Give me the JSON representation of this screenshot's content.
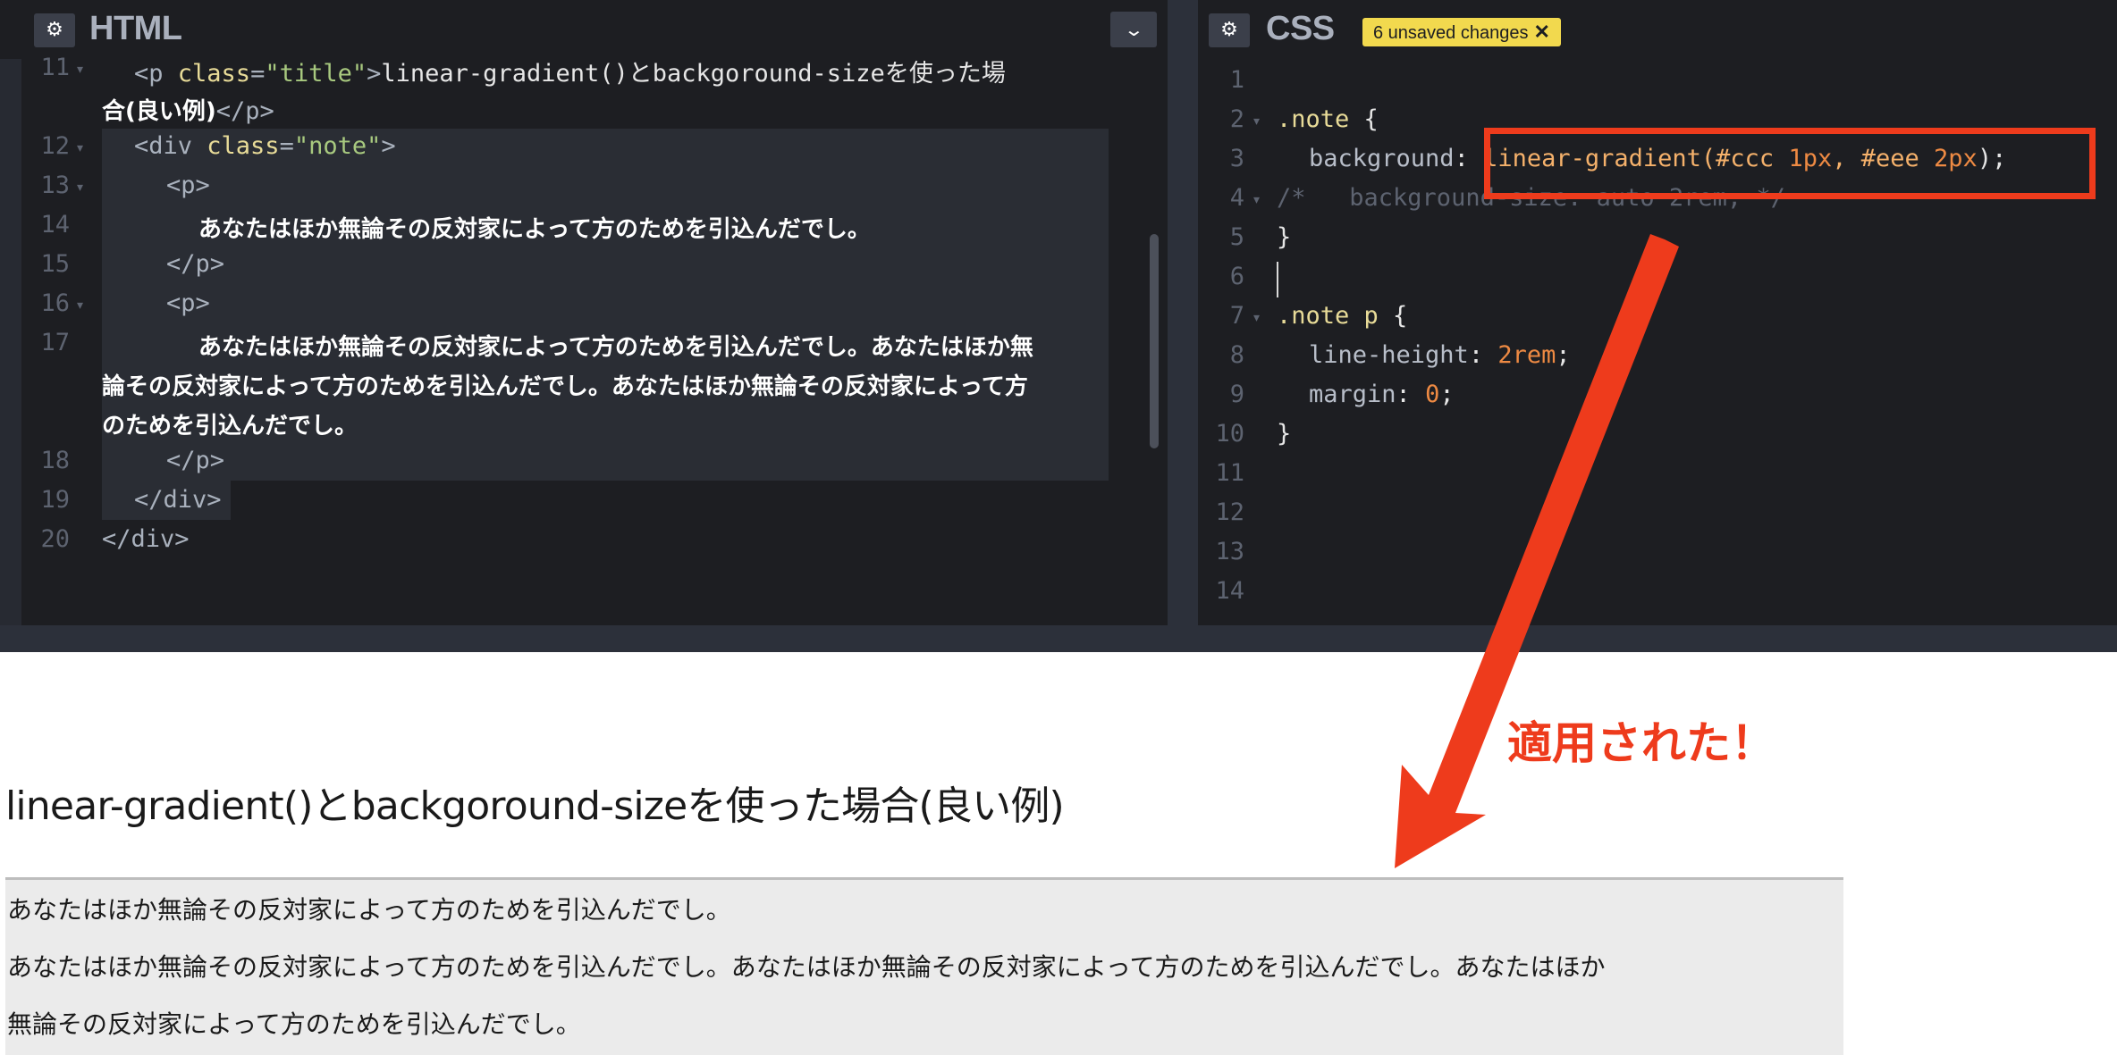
{
  "html_pane": {
    "title": "HTML",
    "settings_icon": "gear-icon",
    "collapse_icon": "chevron-down-icon",
    "lines": [
      {
        "num": "11"
      },
      {
        "num": "12"
      },
      {
        "num": "13"
      },
      {
        "num": "14"
      },
      {
        "num": "15"
      },
      {
        "num": "16"
      },
      {
        "num": "17"
      },
      {
        "num": "18"
      },
      {
        "num": "19"
      },
      {
        "num": "20"
      }
    ],
    "code": {
      "l11_open": "<p ",
      "l11_attr": "class",
      "l11_eq": "=",
      "l11_str": "\"title\"",
      "l11_close": ">",
      "l11_text": "linear-gradient()とbackgoround-sizeを使った場",
      "l11b_text": "合(良い例)",
      "l11b_end": "</p>",
      "l12_open": "<div ",
      "l12_attr": "class",
      "l12_eq": "=",
      "l12_str": "\"note\"",
      "l12_close": ">",
      "l13": "<p>",
      "l14": "あなたはほか無論その反対家によって方のためを引込んだでし。",
      "l15": "</p>",
      "l16": "<p>",
      "l17a": "あなたはほか無論その反対家によって方のためを引込んだでし。あなたはほか無",
      "l17b": "論その反対家によって方のためを引込んだでし。あなたはほか無論その反対家によって方",
      "l17c": "のためを引込んだでし。",
      "l18": "</p>",
      "l19": "</div>",
      "l20": "</div>"
    }
  },
  "css_pane": {
    "title": "CSS",
    "settings_icon": "gear-icon",
    "unsaved_badge": "6 unsaved changes",
    "line_numbers": [
      "1",
      "2",
      "3",
      "4",
      "5",
      "6",
      "7",
      "8",
      "9",
      "10",
      "11",
      "12",
      "13",
      "14"
    ],
    "code": {
      "l2_sel": ".note",
      "l2_brace": " {",
      "l3_prop": "background",
      "l3_colon": ": ",
      "l3_fn": "linear-gradient(#ccc ",
      "l3_num1": "1px",
      "l3_comma": ", #eee ",
      "l3_num2": "2px",
      "l3_end": ");",
      "l4": "/*   background-size: auto 2rem; */",
      "l5": "}",
      "l7_sel": ".note p",
      "l7_brace": " {",
      "l8_prop": "line-height",
      "l8_colon": ": ",
      "l8_val": "2rem",
      "l8_end": ";",
      "l9_prop": "margin",
      "l9_colon": ": ",
      "l9_val": "0",
      "l9_end": ";",
      "l10": "}"
    }
  },
  "preview": {
    "title": "linear-gradient()とbackgoround-sizeを使った場合(良い例)",
    "note_p1": "あなたはほか無論その反対家によって方のためを引込んだでし。",
    "note_p2a": "あなたはほか無論その反対家によって方のためを引込んだでし。あなたはほか無論その反対家によって方のためを引込んだでし。あなたはほか",
    "note_p2b": "無論その反対家によって方のためを引込んだでし。"
  },
  "annotation": {
    "text": "適用された！",
    "color": "#ee3b1c"
  }
}
